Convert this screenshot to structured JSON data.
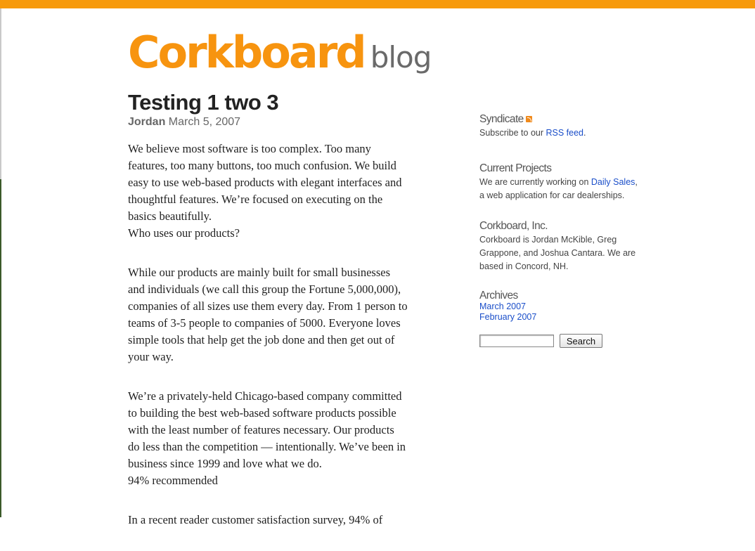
{
  "header": {
    "brand": "Corkboard",
    "subtitle": "blog",
    "accent_color": "#f79a0c"
  },
  "post": {
    "title": "Testing 1 two 3",
    "author": "Jordan",
    "date": "March 5, 2007",
    "paragraphs": [
      {
        "lines": [
          "We believe most software is too complex. Too many",
          "features, too many buttons, too much confusion. We build",
          "easy to use web-based products with elegant interfaces and",
          "thoughtful features. We’re focused on executing on the",
          "basics beautifully.",
          "Who uses our products?"
        ]
      },
      {
        "lines": [
          "While our products are mainly built for small businesses",
          "and individuals (we call this group the Fortune 5,000,000),",
          "companies of all sizes use them every day. From 1 person to",
          "teams of 3-5 people to companies of 5000. Everyone loves",
          "simple tools that help get the job done and then get out of",
          "your way."
        ]
      },
      {
        "lines": [
          "We’re a privately-held Chicago-based company committed",
          "to building the best web-based software products possible",
          "with the least number of features necessary. Our products",
          "do less than the competition — intentionally. We’ve been in",
          "business since 1999 and love what we do.",
          "94% recommended"
        ]
      },
      {
        "lines": [
          "In a recent reader customer satisfaction survey, 94% of"
        ]
      }
    ]
  },
  "sidebar": {
    "syndicate": {
      "heading": "Syndicate",
      "icon": "rss-icon",
      "text_before": "Subscribe to our ",
      "link": "RSS feed",
      "text_after": "."
    },
    "projects": {
      "heading": "Current Projects",
      "text_before": "We are currently working on ",
      "link": "Daily Sales",
      "text_after": ",",
      "line2": "a web application for car dealerships."
    },
    "company": {
      "heading": "Corkboard, Inc.",
      "lines": [
        "Corkboard is Jordan McKible, Greg",
        "Grappone, and Joshua Cantara. We are",
        "based in Concord, NH."
      ]
    },
    "archives": {
      "heading": "Archives",
      "items": [
        "March 2007",
        "February 2007"
      ]
    },
    "search": {
      "input_value": "",
      "button_label": "Search"
    }
  }
}
